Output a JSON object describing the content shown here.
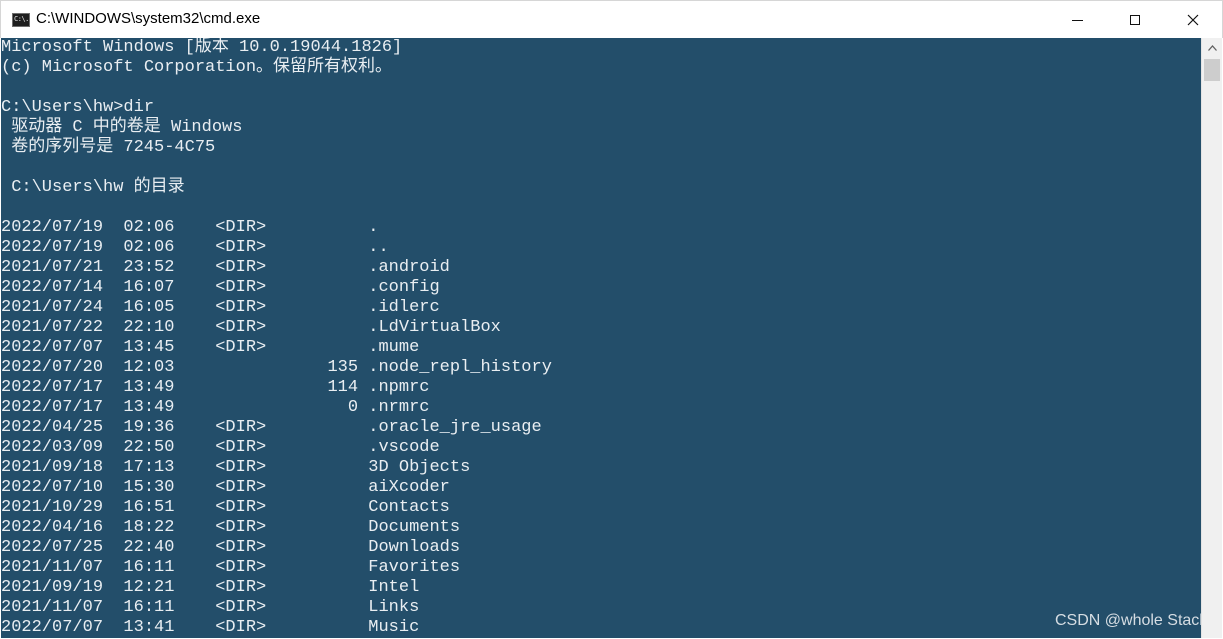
{
  "window": {
    "title": "C:\\WINDOWS\\system32\\cmd.exe",
    "icon": "cmd-icon",
    "icon_text": "C:\\."
  },
  "console": {
    "background": "#234e6a",
    "foreground": "#e9eef2",
    "lines": [
      "Microsoft Windows [版本 10.0.19044.1826]",
      "(c) Microsoft Corporation。保留所有权利。",
      "",
      "C:\\Users\\hw>dir",
      " 驱动器 C 中的卷是 Windows",
      " 卷的序列号是 7245-4C75",
      "",
      " C:\\Users\\hw 的目录",
      "",
      "2022/07/19  02:06    <DIR>          .",
      "2022/07/19  02:06    <DIR>          ..",
      "2021/07/21  23:52    <DIR>          .android",
      "2022/07/14  16:07    <DIR>          .config",
      "2021/07/24  16:05    <DIR>          .idlerc",
      "2021/07/22  22:10    <DIR>          .LdVirtualBox",
      "2022/07/07  13:45    <DIR>          .mume",
      "2022/07/20  12:03               135 .node_repl_history",
      "2022/07/17  13:49               114 .npmrc",
      "2022/07/17  13:49                 0 .nrmrc",
      "2022/04/25  19:36    <DIR>          .oracle_jre_usage",
      "2022/03/09  22:50    <DIR>          .vscode",
      "2021/09/18  17:13    <DIR>          3D Objects",
      "2022/07/10  15:30    <DIR>          aiXcoder",
      "2021/10/29  16:51    <DIR>          Contacts",
      "2022/04/16  18:22    <DIR>          Documents",
      "2022/07/25  22:40    <DIR>          Downloads",
      "2021/11/07  16:11    <DIR>          Favorites",
      "2021/09/19  12:21    <DIR>          Intel",
      "2021/11/07  16:11    <DIR>          Links",
      "2022/07/07  13:41    <DIR>          Music"
    ]
  },
  "watermark": "CSDN @whole Stack"
}
